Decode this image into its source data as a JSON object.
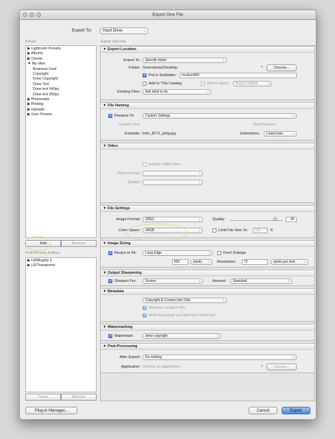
{
  "window": {
    "title": "Export One File"
  },
  "export_to": {
    "label": "Export To:",
    "value": "Hard Drive"
  },
  "left": {
    "preset_label": "Preset:",
    "presets": [
      "▶ Lightroom Presets",
      "▶ Albums",
      "▶ Clients",
      "▼ My sites",
      "    Business Card",
      "    Copyright",
      "    Drew Copyright",
      "    Drew Text",
      "    Drew text 640px",
      "    Drew text 800px",
      "▶ Photomatix",
      "▶ Printing",
      "▶ Uploads",
      "▶ User Presets"
    ],
    "add_label": "Add",
    "remove_label": "Remove",
    "post_process_label": "Post-Process Actions",
    "post_process_items": [
      "▶ LR/Mogrify 2",
      "▶ LR/Transporter"
    ],
    "insert_label": "Insert",
    "remove2_label": "Remove"
  },
  "main": {
    "header": "Export One File",
    "export_location": {
      "title": "▼ Export Location",
      "export_to_label": "Export To:",
      "export_to_value": "Specific folder",
      "folder_label": "Folder:",
      "folder_value": "/Users/andy/Desktop",
      "choose_label": "Choose...",
      "subfolder_label": "Put in Subfolder:",
      "subfolder_value": "medium800",
      "add_catalog_label": "Add to This Catalog",
      "add_stack_label": "Add to Stack:",
      "below_original": "Below Original",
      "existing_label": "Existing Files:",
      "existing_value": "Ask what to do"
    },
    "file_naming": {
      "title": "▼ File Naming",
      "rename_label": "Rename To:",
      "rename_value": "Custom Settings",
      "custom_text_label": "Custom Text:",
      "start_number_label": "Start Number:",
      "example_label": "Example:",
      "example_value": "lndn_8272_prbg.jpg",
      "extensions_label": "Extensions:",
      "extensions_value": "Lowercase"
    },
    "video": {
      "title": "▼ Video",
      "include_label": "Include Video Files:",
      "format_label": "Video Format:",
      "quality_label": "Quality:"
    },
    "file_settings": {
      "title": "▼ File Settings",
      "format_label": "Image Format:",
      "format_value": "JPEG",
      "quality_label": "Quality:",
      "quality_value": "85",
      "quality_level": 0.85,
      "colorspace_label": "Color Space:",
      "colorspace_value": "sRGB",
      "limit_label": "Limit File Size To:",
      "limit_value": "100",
      "limit_unit": "K"
    },
    "image_sizing": {
      "title": "▼ Image Sizing",
      "resize_label": "Resize to Fit:",
      "resize_value": "Long Edge",
      "enlarge_label": "Don't Enlarge",
      "size_value": "800",
      "size_unit": "pixels",
      "resolution_label": "Resolution:",
      "resolution_value": "72",
      "resolution_unit": "pixels per inch"
    },
    "output_sharpening": {
      "title": "▼ Output Sharpening",
      "sharpen_label": "Sharpen For:",
      "sharpen_value": "Screen",
      "amount_label": "Amount:",
      "amount_value": "Standard"
    },
    "metadata": {
      "title": "▼ Metadata",
      "metadata_value": "Copyright & Contact Info Only",
      "remove_location_label": "Remove Location Info",
      "write_keywords_label": "Write Keywords as Lightroom Hierarchy"
    },
    "watermarking": {
      "title": "▼ Watermarking",
      "watermark_label": "Watermark:",
      "watermark_value": "drew copyright"
    },
    "post_processing": {
      "title": "▼ Post-Processing",
      "after_label": "After Export:",
      "after_value": "Do nothing",
      "application_label": "Application:",
      "application_placeholder": "Choose an application...",
      "choose_label": "Choose..."
    }
  },
  "footer": {
    "plugin_label": "Plug-in Manager...",
    "cancel_label": "Cancel",
    "export_label": "Export"
  },
  "colors": {
    "accent": "#5a8ad8",
    "highlight_circle": "#e6d77a"
  }
}
